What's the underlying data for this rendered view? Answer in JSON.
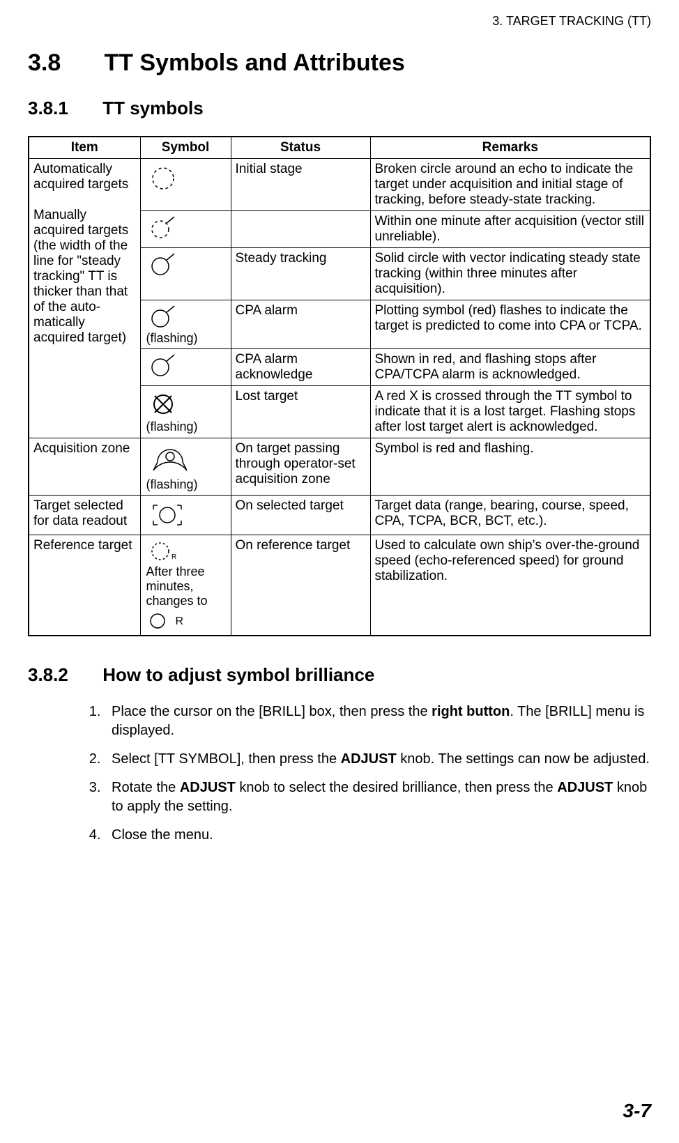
{
  "running_head": "3.  TARGET TRACKING (TT)",
  "h1": {
    "num": "3.8",
    "title": "TT Symbols and Attributes"
  },
  "h2a": {
    "num": "3.8.1",
    "title": "TT symbols"
  },
  "h2b": {
    "num": "3.8.2",
    "title": "How to adjust symbol brilliance"
  },
  "page_number": "3-7",
  "table": {
    "headers": {
      "item": "Item",
      "symbol": "Symbol",
      "status": "Status",
      "remarks": "Remarks"
    },
    "item_auto": "Automatically acquired targets\n\nManually acquired targets (the width of the line for \"steady tracking\" TT is thicker than that of the auto-matically acquired target)",
    "item_acq_zone": "Acquisition zone",
    "item_selected": "Target selected for data readout",
    "item_reference": "Reference target",
    "rows": {
      "r1": {
        "symbol_note": "",
        "status": "Initial stage",
        "remarks": "Broken circle around an echo to indicate the target under acquisition and initial stage of tracking, before steady-state tracking."
      },
      "r2": {
        "symbol_note": "",
        "status": "",
        "remarks": "Within one minute after acquisition (vector still unreliable)."
      },
      "r3": {
        "symbol_note": "",
        "status": "Steady tracking",
        "remarks": "Solid circle with vector indicating steady state tracking (within three minutes after acquisition)."
      },
      "r4": {
        "symbol_note": "(flashing)",
        "status": "CPA alarm",
        "remarks": "Plotting symbol (red) flashes to indicate the target is predicted to come into CPA or TCPA."
      },
      "r5": {
        "symbol_note": "",
        "status": "CPA alarm acknowledge",
        "remarks": "Shown in red, and flashing stops after CPA/TCPA alarm is acknowledged."
      },
      "r6": {
        "symbol_note": "(flashing)",
        "status": "Lost target",
        "remarks": "A red X is crossed through the TT symbol to indicate that it is a lost target. Flashing stops after lost target alert is acknowledged."
      },
      "r7": {
        "symbol_note": "(flashing)",
        "status": "On target passing through operator-set acquisition zone",
        "remarks": "Symbol is red and flashing."
      },
      "r8": {
        "symbol_note": "",
        "status": "On selected target",
        "remarks": "Target data (range, bearing, course, speed, CPA, TCPA, BCR, BCT, etc.)."
      },
      "r9": {
        "symbol_note_a": "After three minutes, changes to",
        "symbol_note_b": "R",
        "status": "On reference target",
        "remarks": "Used to calculate own ship’s over-the-ground speed (echo-referenced speed) for ground stabilization."
      }
    }
  },
  "steps": {
    "s1_a": "Place the cursor on the [BRILL] box, then press the ",
    "s1_bold": "right button",
    "s1_b": ". The [BRILL] menu is displayed.",
    "s2_a": "Select [TT SYMBOL], then press the ",
    "s2_bold": "ADJUST",
    "s2_b": " knob. The settings can now be adjusted.",
    "s3_a": "Rotate the ",
    "s3_bold1": "ADJUST",
    "s3_b": " knob to select the desired brilliance, then press the ",
    "s3_bold2": "ADJUST",
    "s3_c": " knob to apply the setting.",
    "s4": "Close the menu."
  }
}
